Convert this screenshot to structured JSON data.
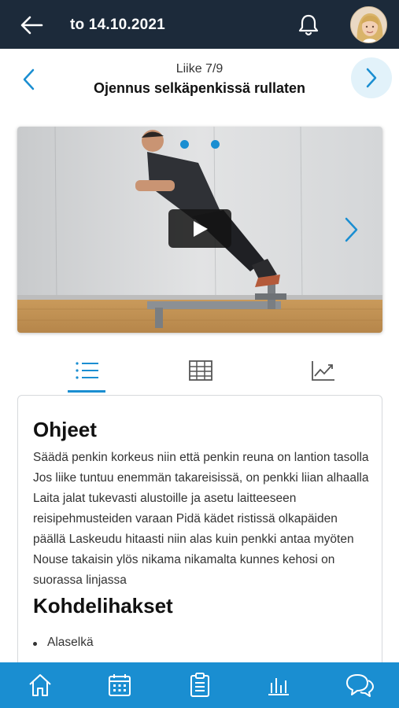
{
  "header": {
    "title": "to 14.10.2021",
    "back_icon": "arrow-left-icon",
    "notification_icon": "bell-icon",
    "avatar": "user-avatar"
  },
  "exercise": {
    "counter": "Liike 7/9",
    "name": "Ojennus selkäpenkissä rullaten",
    "prev_icon": "chevron-left-icon",
    "next_icon": "chevron-right-icon"
  },
  "media": {
    "slides": 2,
    "active_slide": 1,
    "play_icon": "play-icon"
  },
  "tabs": [
    {
      "name": "instructions",
      "icon": "list-icon",
      "active": true
    },
    {
      "name": "table",
      "icon": "table-grid-icon",
      "active": false
    },
    {
      "name": "progress",
      "icon": "trend-chart-icon",
      "active": false
    }
  ],
  "content": {
    "instructions_title": "Ohjeet",
    "instructions_text": "Säädä penkin korkeus niin että penkin reuna on lantion tasolla Jos liike tuntuu enemmän takareisissä, on penkki liian alhaalla Laita jalat tukevasti alustoille ja asetu laitteeseen reisipehmusteiden varaan Pidä kädet ristissä olkapäiden päällä Laskeudu hitaasti niin alas kuin penkki antaa myöten Nouse takaisin ylös nikama nikamalta kunnes kehosi on suorassa linjassa",
    "muscles_title": "Kohdelihakset",
    "muscles": [
      "Alaselkä"
    ]
  },
  "bottom_nav": [
    {
      "name": "home",
      "icon": "home-icon"
    },
    {
      "name": "calendar",
      "icon": "calendar-icon"
    },
    {
      "name": "clipboard",
      "icon": "clipboard-icon"
    },
    {
      "name": "stats",
      "icon": "bar-chart-icon"
    },
    {
      "name": "chat",
      "icon": "chat-icon"
    }
  ],
  "colors": {
    "header_bg": "#1c2a3a",
    "accent": "#1a8ed1",
    "next_button_bg": "#e2f2fa"
  }
}
